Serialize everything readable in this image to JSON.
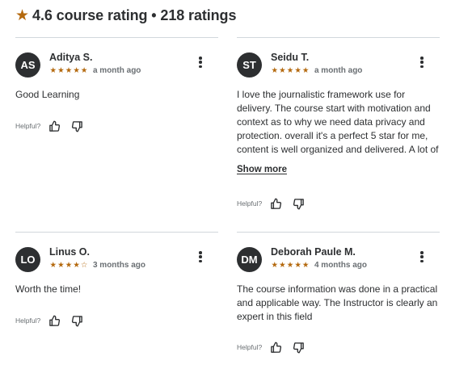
{
  "header": {
    "rating": "4.6",
    "rating_text": "4.6 course rating • 218 ratings"
  },
  "colors": {
    "star": "#b4690e",
    "avatar": "#2d2f31",
    "divider": "#d1d7dc"
  },
  "reviews": [
    {
      "initials": "AS",
      "name": "Aditya S.",
      "rating": 5,
      "time": "a month ago",
      "text": "Good Learning",
      "helpful_label": "Helpful?"
    },
    {
      "initials": "ST",
      "name": "Seidu T.",
      "rating": 5,
      "time": "a month ago",
      "text": "I love the journalistic framework use for delivery. The course start with motivation and context as to why we need data privacy and protection. overall it's a perfect 5 star for me, content is well organized and delivered. A lot of",
      "show_more_label": "Show more",
      "helpful_label": "Helpful?"
    },
    {
      "initials": "LO",
      "name": "Linus O.",
      "rating": 4,
      "time": "3 months ago",
      "text": "Worth the time!",
      "helpful_label": "Helpful?"
    },
    {
      "initials": "DM",
      "name": "Deborah Paule M.",
      "rating": 5,
      "time": "4 months ago",
      "text": "The course information was done in a practical and applicable way. The Instructor is clearly an expert in this field",
      "helpful_label": "Helpful?"
    }
  ]
}
